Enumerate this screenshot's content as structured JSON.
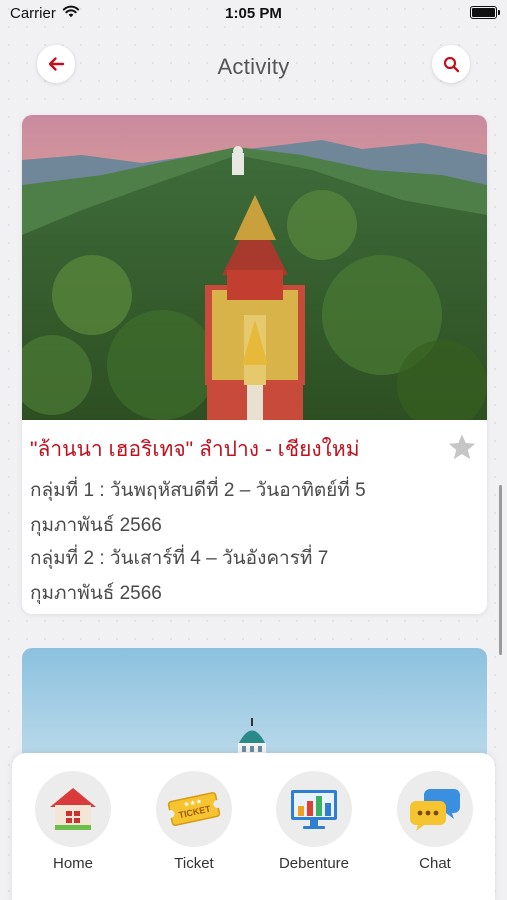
{
  "status_bar": {
    "carrier": "Carrier",
    "time": "1:05 PM"
  },
  "header": {
    "title": "Activity",
    "back_icon": "back-arrow-icon",
    "search_icon": "search-icon"
  },
  "activity_card": {
    "title": "\"ล้านนา เฮอริเทจ\" ลำปาง - เชียงใหม่",
    "lines": [
      "กลุ่มที่ 1 : วันพฤหัสบดีที่ 2 – วันอาทิตย์ที่ 5",
      "กุมภาพันธ์ 2566",
      "กลุ่มที่ 2 : วันเสาร์ที่ 4 – วันอังคารที่ 7",
      "กุมภาพันธ์ 2566"
    ],
    "favorite_icon": "star-icon"
  },
  "tabs": [
    {
      "label": "Home",
      "icon": "home-icon"
    },
    {
      "label": "Ticket",
      "icon": "ticket-icon"
    },
    {
      "label": "Debenture",
      "icon": "debenture-icon"
    },
    {
      "label": "Chat",
      "icon": "chat-icon"
    }
  ],
  "colors": {
    "accent": "#c0111f",
    "background": "#f1f1f3",
    "card": "#ffffff"
  }
}
